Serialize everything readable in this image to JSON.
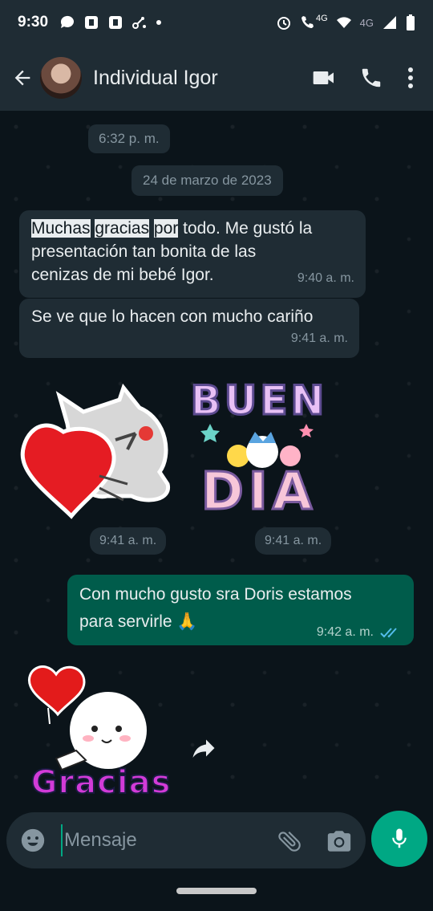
{
  "status_bar": {
    "time": "9:30",
    "network_label": "4G",
    "network_label_2": "4G"
  },
  "header": {
    "contact_name": "Individual Igor",
    "icons": [
      "back-arrow-icon",
      "avatar",
      "video-call-icon",
      "phone-icon",
      "more-vert-icon"
    ]
  },
  "chat": {
    "first_time": "6:32 p. m.",
    "date_divider": "24 de marzo de 2023",
    "msg1": {
      "hl1": "Muchas",
      "hl2": "gracias",
      "hl3": "por",
      "line1_rest": " todo. Me gustó la",
      "line2": "presentación tan bonita de las",
      "line3": "cenizas de mi bebé Igor.",
      "time": "9:40 a. m."
    },
    "msg2": {
      "text": "Se ve que lo hacen con mucho cariño",
      "time": "9:41 a. m."
    },
    "sticker1": {
      "time": "9:41 a. m."
    },
    "sticker2": {
      "text_top": "BUEN",
      "text_bottom": "DIA",
      "time": "9:41 a. m."
    },
    "msg3": {
      "line1": "Con mucho gusto sra Doris estamos",
      "line2": "para servirle 🙏",
      "time": "9:42 a. m."
    },
    "sticker3": {
      "text": "Gracias"
    }
  },
  "input": {
    "placeholder": "Mensaje"
  },
  "colors": {
    "header_bg": "#1f2c34",
    "chat_bg": "#0b141a",
    "incoming_bubble": "#1f2c34",
    "outgoing_bubble": "#005c4b",
    "accent": "#00a884",
    "read_ticks": "#53bdeb"
  }
}
